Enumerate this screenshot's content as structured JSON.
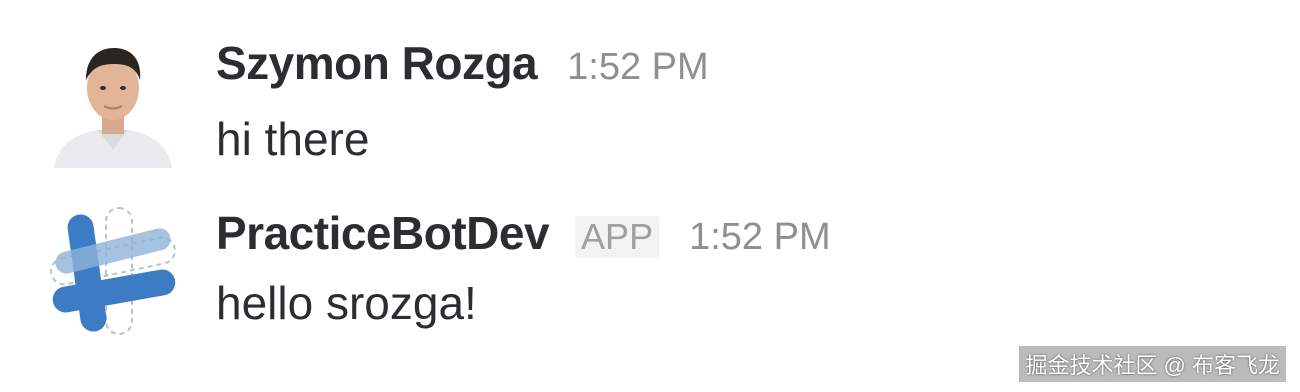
{
  "messages": [
    {
      "author": "Szymon Rozga",
      "time": "1:52 PM",
      "text": "hi there",
      "avatar": "user-photo-avatar"
    },
    {
      "author": "PracticeBotDev",
      "badge": "APP",
      "time": "1:52 PM",
      "text": "hello srozga!",
      "avatar": "bot-logo-avatar"
    }
  ],
  "watermark": "掘金技术社区 @ 布客飞龙",
  "colors": {
    "text": "#2c2d30",
    "muted": "#8f8f91",
    "bot_blue": "#3b7cc4"
  }
}
